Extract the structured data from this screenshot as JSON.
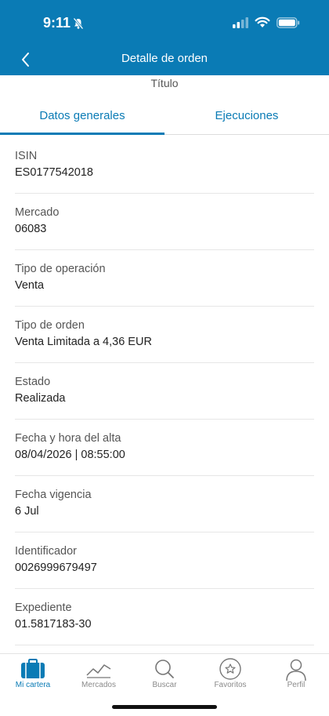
{
  "status": {
    "time": "9:11"
  },
  "nav": {
    "title": "Detalle de orden"
  },
  "subtitle": "Título",
  "tabs": [
    {
      "label": "Datos generales",
      "active": true
    },
    {
      "label": "Ejecuciones",
      "active": false
    }
  ],
  "fields": [
    {
      "label": "ISIN",
      "value": "ES0177542018"
    },
    {
      "label": "Mercado",
      "value": "06083"
    },
    {
      "label": "Tipo de operación",
      "value": "Venta"
    },
    {
      "label": "Tipo de orden",
      "value": "Venta Limitada a 4,36 EUR"
    },
    {
      "label": "Estado",
      "value": "Realizada"
    },
    {
      "label": "Fecha y hora del alta",
      "value": "08/04/2026 | 08:55:00"
    },
    {
      "label": "Fecha vigencia",
      "value": "6 Jul"
    },
    {
      "label": "Identificador",
      "value": "0026999679497"
    },
    {
      "label": "Expediente",
      "value": "01.5817183-30"
    }
  ],
  "tabbar": [
    {
      "label": "Mi cartera",
      "icon": "briefcase-icon",
      "active": true
    },
    {
      "label": "Mercados",
      "icon": "chart-line-icon",
      "active": false
    },
    {
      "label": "Buscar",
      "icon": "search-icon",
      "active": false
    },
    {
      "label": "Favoritos",
      "icon": "star-icon",
      "active": false
    },
    {
      "label": "Perfil",
      "icon": "user-icon",
      "active": false
    }
  ],
  "colors": {
    "primary": "#0a7bb5",
    "inactive": "#8a8a8a"
  }
}
